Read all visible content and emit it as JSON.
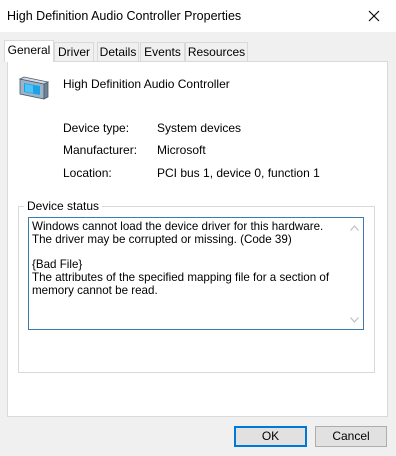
{
  "window": {
    "title": "High Definition Audio Controller Properties",
    "close_icon": "close-icon"
  },
  "tabs": [
    {
      "label": "General",
      "active": true
    },
    {
      "label": "Driver",
      "active": false
    },
    {
      "label": "Details",
      "active": false
    },
    {
      "label": "Events",
      "active": false
    },
    {
      "label": "Resources",
      "active": false
    }
  ],
  "device": {
    "icon": "audio-controller-icon",
    "name": "High Definition Audio Controller",
    "properties": [
      {
        "label": "Device type:",
        "value": "System devices"
      },
      {
        "label": "Manufacturer:",
        "value": "Microsoft"
      },
      {
        "label": "Location:",
        "value": "PCI bus 1, device 0, function 1"
      }
    ]
  },
  "status": {
    "legend": "Device status",
    "text": "Windows cannot load the device driver for this hardware. The driver may be corrupted or missing. (Code 39)\n\n{Bad File}\nThe attributes of the specified mapping file for a section of memory cannot be read."
  },
  "buttons": {
    "ok_label": "OK",
    "cancel_label": "Cancel"
  },
  "colors": {
    "accent": "#0078d7",
    "status_border": "#3d7bad"
  }
}
